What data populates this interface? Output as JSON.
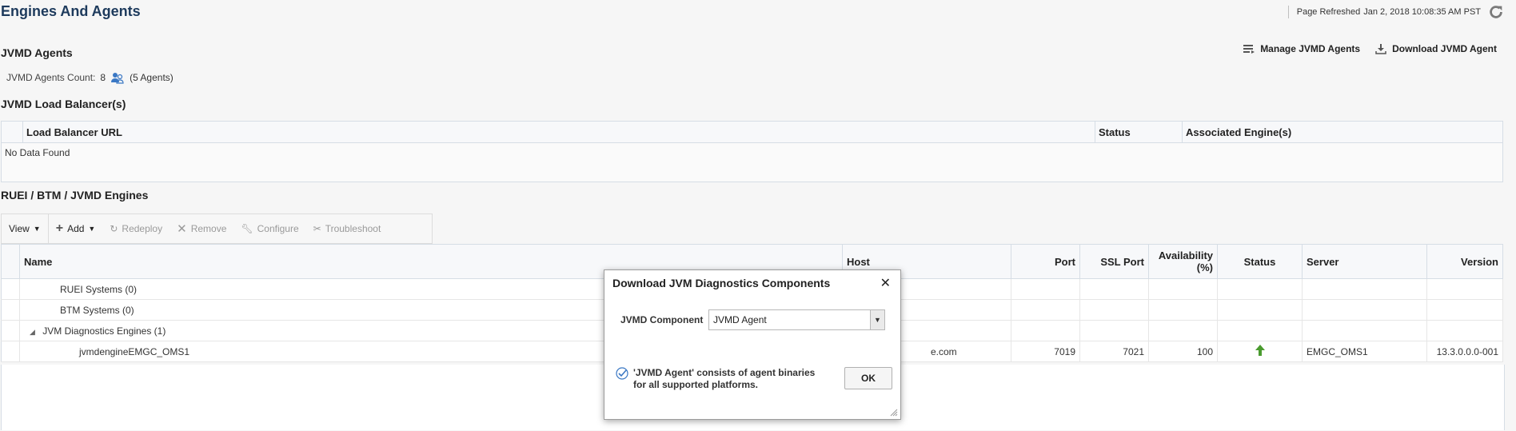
{
  "page": {
    "title": "Engines And Agents",
    "refresh_label": "Page Refreshed",
    "refresh_time": "Jan 2, 2018 10:08:35 AM PST"
  },
  "jvmd_agents": {
    "title": "JVMD Agents",
    "count_label": "JVMD Agents Count:",
    "count_value": "8",
    "count_detail": "(5 Agents)",
    "actions": {
      "manage": "Manage JVMD Agents",
      "download": "Download JVMD Agent"
    }
  },
  "load_balancers": {
    "title": "JVMD Load Balancer(s)",
    "columns": [
      "Load Balancer URL",
      "Status",
      "Associated Engine(s)"
    ],
    "empty_text": "No Data Found"
  },
  "engines": {
    "title": "RUEI / BTM / JVMD Engines",
    "toolbar": {
      "view": "View",
      "add": "Add",
      "redeploy": "Redeploy",
      "remove": "Remove",
      "configure": "Configure",
      "troubleshoot": "Troubleshoot"
    },
    "columns": {
      "name": "Name",
      "host": "Host",
      "port": "Port",
      "ssl_port": "SSL Port",
      "availability": "Availability (%)",
      "status": "Status",
      "server": "Server",
      "version": "Version"
    },
    "rows": [
      {
        "name": "RUEI Systems (0)"
      },
      {
        "name": "BTM Systems (0)"
      },
      {
        "name": "JVM Diagnostics Engines (1)"
      },
      {
        "name": "jvmdengineEMGC_OMS1",
        "host": "e.com",
        "port": "7019",
        "ssl_port": "7021",
        "availability": "100",
        "status": "up-arrow-icon",
        "server": "EMGC_OMS1",
        "version": "13.3.0.0.0-001"
      }
    ]
  },
  "dialog": {
    "title": "Download JVM Diagnostics Components",
    "field_label": "JVMD Component",
    "selected": "JVMD Agent",
    "info": "'JVMD Agent' consists of agent binaries for all supported platforms.",
    "ok": "OK"
  },
  "colors": {
    "title": "#1d3a5c",
    "link": "#1f5c97",
    "status_up": "#4a9b2f"
  }
}
